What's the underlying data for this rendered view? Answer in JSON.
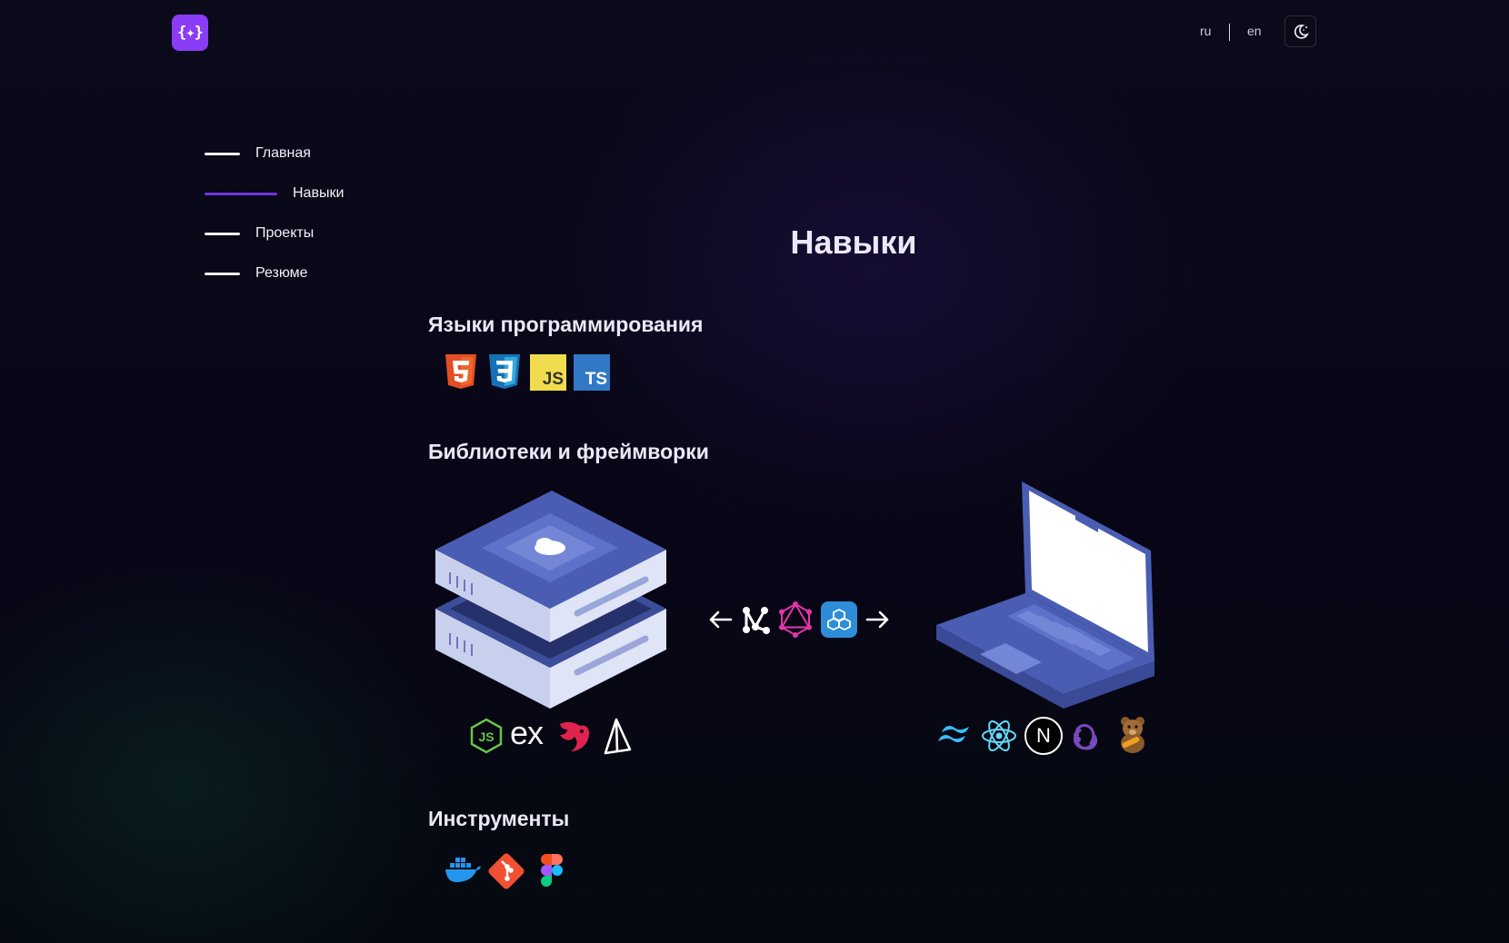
{
  "header": {
    "logo_text": "{✦}",
    "lang_ru": "ru",
    "lang_en": "en"
  },
  "nav": {
    "items": [
      {
        "label": "Главная",
        "active": false
      },
      {
        "label": "Навыки",
        "active": true
      },
      {
        "label": "Проекты",
        "active": false
      },
      {
        "label": "Резюме",
        "active": false
      }
    ]
  },
  "page": {
    "title": "Навыки"
  },
  "sections": {
    "languages": {
      "heading": "Языки программирования",
      "icons": [
        "html5-icon",
        "css3-icon",
        "javascript-icon",
        "typescript-icon"
      ]
    },
    "frameworks": {
      "heading": "Библиотеки и фреймворки",
      "middle_icons": [
        "rest-api-icon",
        "graphql-icon",
        "websocket-icon"
      ],
      "backend_icons": [
        "nodejs-icon",
        "express-icon",
        "nestjs-icon",
        "prisma-icon"
      ],
      "frontend_icons": [
        "tailwind-icon",
        "react-icon",
        "nextjs-icon",
        "redux-icon",
        "mobx-icon"
      ],
      "js_badge": "JS",
      "ts_badge": "TS",
      "express_text": "ex",
      "next_letter": "N"
    },
    "tools": {
      "heading": "Инструменты",
      "icons": [
        "docker-icon",
        "git-icon",
        "figma-icon"
      ]
    }
  },
  "colors": {
    "accent": "#8b3cf6",
    "active_line": "#6d35e0",
    "background": "#0a0a1a"
  }
}
